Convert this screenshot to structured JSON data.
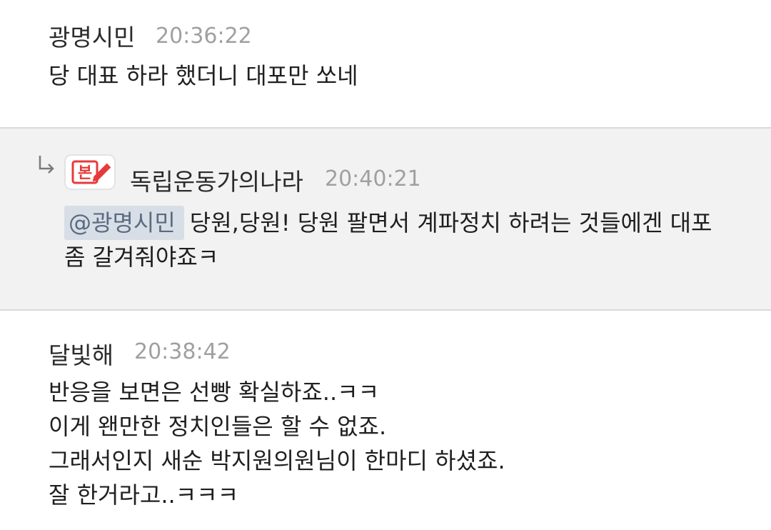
{
  "comments": [
    {
      "author": "광명시민",
      "time": "20:36:22",
      "lines": [
        "당 대표 하라 했더니 대포만 쏘네"
      ]
    },
    {
      "author": "독립운동가의나라",
      "time": "20:40:21",
      "badge_text": "본",
      "badge_icon": "pencil-icon",
      "mention": "@광명시민",
      "lines": [
        "당원,당원! 당원 팔면서 계파정치 하려는 것들에겐 대포",
        "좀 갈겨줘야죠ㅋ"
      ]
    },
    {
      "author": "달빛해",
      "time": "20:38:42",
      "lines": [
        "반응을 보면은 선빵 확실하죠..ㅋㅋ",
        "이게 왠만한 정치인들은 할 수 없죠.",
        "그래서인지 새순 박지원의원님이 한마디 하셨죠.",
        "잘 한거라고..ㅋㅋㅋ"
      ]
    }
  ],
  "colors": {
    "reply_background": "#f2f2f2",
    "mention_background": "#d8dee6",
    "badge_red": "#e8393a",
    "timestamp": "#a0a0a0"
  }
}
